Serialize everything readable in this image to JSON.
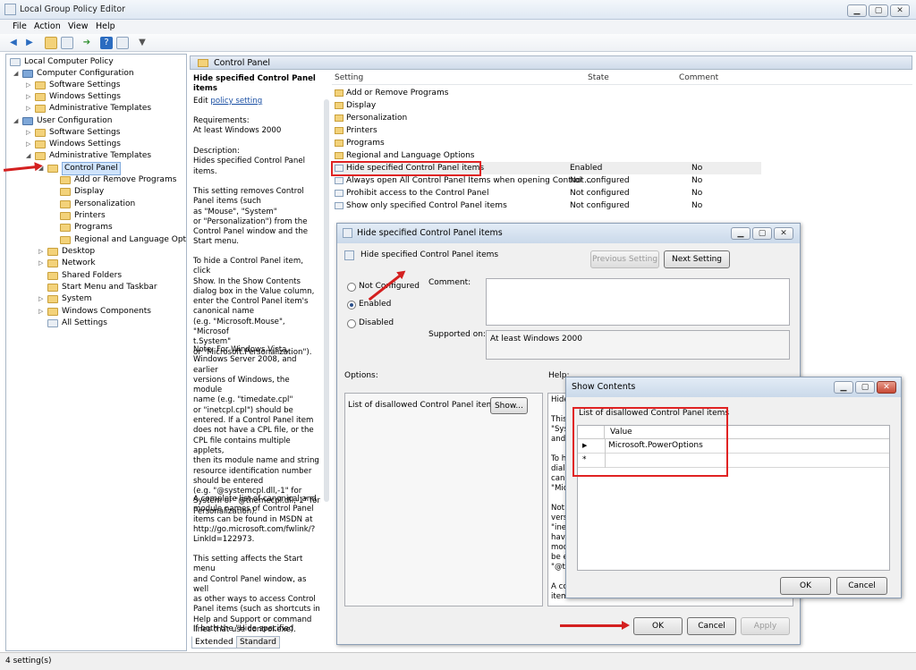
{
  "window": {
    "title": "Local Group Policy Editor"
  },
  "menu": {
    "file": "File",
    "action": "Action",
    "view": "View",
    "help": "Help"
  },
  "tree": {
    "root": "Local Computer Policy",
    "computer_config": "Computer Configuration",
    "cc_software": "Software Settings",
    "cc_windows": "Windows Settings",
    "cc_admin": "Administrative Templates",
    "user_config": "User Configuration",
    "uc_software": "Software Settings",
    "uc_windows": "Windows Settings",
    "uc_admin": "Administrative Templates",
    "control_panel": "Control Panel",
    "add_remove": "Add or Remove Programs",
    "display": "Display",
    "personalization": "Personalization",
    "printers": "Printers",
    "programs": "Programs",
    "regional": "Regional and Language Options",
    "desktop": "Desktop",
    "network": "Network",
    "shared_folders": "Shared Folders",
    "start_menu": "Start Menu and Taskbar",
    "system": "System",
    "windows_components": "Windows Components",
    "all_settings": "All Settings"
  },
  "main": {
    "header": "Control Panel"
  },
  "description": {
    "title": "Hide specified Control Panel items",
    "edit_prefix": "Edit",
    "edit_link": "policy setting",
    "requirements": "Requirements:\nAt least Windows 2000",
    "description": "Description:\nHides specified Control Panel\nitems.",
    "p1": "This setting removes Control\nPanel items (such\nas \"Mouse\", \"System\"\nor \"Personalization\") from the\nControl Panel window and the\nStart menu.",
    "p2": "To hide a Control Panel item, click\nShow. In the Show Contents\ndialog box in the Value column,\nenter the Control Panel item's\ncanonical name\n(e.g. \"Microsoft.Mouse\", \"Microsof\nt.System\"\nor \"Microsoft.Personalization\").",
    "p3": "Note: For Windows Vista,\nWindows Server 2008, and earlier\nversions of Windows, the module\nname (e.g. \"timedate.cpl\"\nor \"inetcpl.cpl\") should be\nentered. If a Control Panel item\ndoes not have a CPL file, or the\nCPL file contains multiple applets,\nthen its module name and string\nresource identification number\nshould be entered\n(e.g. \"@systemcpl.dll,-1\" for\nSystem or \"@themecpl.dll,-1\" for\nPersonalization).",
    "p4": "A complete list of canonical and\nmodule names of Control Panel\nitems can be found in MSDN at\nhttp://go.microsoft.com/fwlink/?\nLinkId=122973.",
    "p5": "This setting affects the Start menu\nand Control Panel window, as well\nas other ways to access Control\nPanel items (such as shortcuts in\nHelp and Support or command\nlines that use control.exe).",
    "p6": "If both the \"Hide specified Control"
  },
  "list": {
    "headers": {
      "setting": "Setting",
      "state": "State",
      "comment": "Comment"
    },
    "folders": [
      "Add or Remove Programs",
      "Display",
      "Personalization",
      "Printers",
      "Programs",
      "Regional and Language Options"
    ],
    "settings": [
      {
        "name": "Hide specified Control Panel items",
        "state": "Enabled",
        "comment": "No"
      },
      {
        "name": "Always open All Control Panel Items when opening Control ...",
        "state": "Not configured",
        "comment": "No"
      },
      {
        "name": "Prohibit access to the Control Panel",
        "state": "Not configured",
        "comment": "No"
      },
      {
        "name": "Show only specified Control Panel items",
        "state": "Not configured",
        "comment": "No"
      }
    ]
  },
  "tabs": {
    "extended": "Extended",
    "standard": "Standard"
  },
  "status": {
    "text": "4 setting(s)"
  },
  "policy_dialog": {
    "title": "Hide specified Control Panel items",
    "setting_name": "Hide specified Control Panel items",
    "prev_button": "Previous Setting",
    "next_button": "Next Setting",
    "not_configured": "Not Configured",
    "enabled": "Enabled",
    "disabled": "Disabled",
    "selected_state": "enabled",
    "comment_label": "Comment:",
    "supported_label": "Supported on:",
    "supported_value": "At least Windows 2000",
    "options_label": "Options:",
    "help_label": "Help:",
    "option_list_label": "List of disallowed Control Panel items",
    "show_button": "Show...",
    "help_text": "Hide\n\nThis\n\"Sys\nand\n\nTo h\ndialo\ncano\n\"Mic\n\nNot\nvers\n\"ine\nhave\nmod\nbe e\n\"@t\n\nA co\nitem",
    "ok": "OK",
    "cancel": "Cancel",
    "apply": "Apply"
  },
  "show_dialog": {
    "title": "Show Contents",
    "list_label": "List of disallowed Control Panel items",
    "col_value": "Value",
    "row1_marker": "▶",
    "row1_value": "Microsoft.PowerOptions",
    "row2_marker": "*",
    "ok": "OK",
    "cancel": "Cancel"
  },
  "colors": {
    "highlight_red": "#e02323",
    "selection_blue": "#cfe3fb",
    "link": "#1a4fa3"
  }
}
